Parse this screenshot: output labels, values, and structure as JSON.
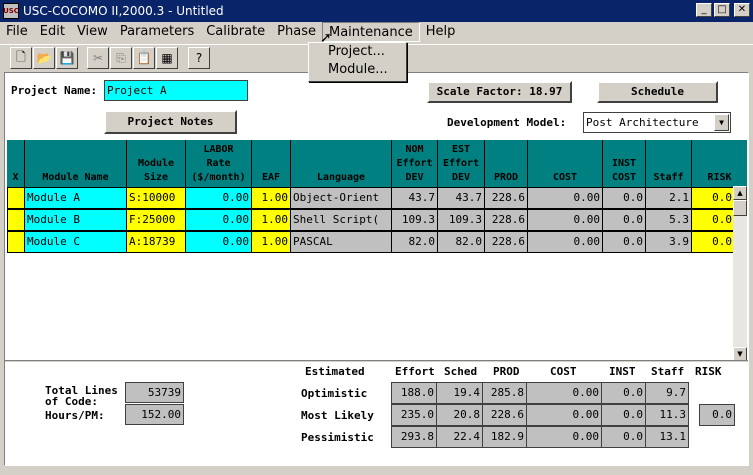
{
  "window": {
    "title": "USC-COCOMO II,2000.3 - Untitled",
    "icon_label": "USC"
  },
  "menu": [
    "File",
    "Edit",
    "View",
    "Parameters",
    "Calibrate",
    "Phase",
    "Maintenance",
    "Help"
  ],
  "maintenance_menu": [
    "Project...",
    "Module..."
  ],
  "toolbar_icons": [
    "new-file-icon",
    "open-folder-icon",
    "save-icon",
    "cut-icon",
    "copy-icon",
    "paste-icon",
    "insert-module-icon",
    "help-icon"
  ],
  "project": {
    "name_label": "Project Name:",
    "name_value": "Project A",
    "notes_button": "Project Notes",
    "scale_factor_button": "Scale Factor: 18.97",
    "schedule_button": "Schedule",
    "dev_model_label": "Development Model:",
    "dev_model_value": "Post Architecture"
  },
  "grid": {
    "headers": [
      "X",
      "Module Name",
      "Module\nSize",
      "LABOR\nRate\n($/month)",
      "EAF",
      "Language",
      "NOM\nEffort\nDEV",
      "EST\nEffort\nDEV",
      "PROD",
      "COST",
      "INST\nCOST",
      "Staff",
      "RISK"
    ],
    "rows": [
      {
        "x": "",
        "name": "Module A",
        "size": "S:10000",
        "labor": "0.00",
        "eaf": "1.00",
        "language": "Object-Orient",
        "nom": "43.7",
        "est": "43.7",
        "prod": "228.6",
        "cost": "0.00",
        "inst": "0.0",
        "staff": "2.1",
        "risk": "0.0"
      },
      {
        "x": "",
        "name": "Module B",
        "size": "F:25000",
        "labor": "0.00",
        "eaf": "1.00",
        "language": "Shell Script(",
        "nom": "109.3",
        "est": "109.3",
        "prod": "228.6",
        "cost": "0.00",
        "inst": "0.0",
        "staff": "5.3",
        "risk": "0.0"
      },
      {
        "x": "",
        "name": "Module C",
        "size": "A:18739",
        "labor": "0.00",
        "eaf": "1.00",
        "language": "PASCAL",
        "nom": "82.0",
        "est": "82.0",
        "prod": "228.6",
        "cost": "0.00",
        "inst": "0.0",
        "staff": "3.9",
        "risk": "0.0"
      }
    ]
  },
  "summary": {
    "total_loc_label_1": "Total Lines",
    "total_loc_label_2": "of Code:",
    "total_loc": "53739",
    "hours_label": "Hours/PM:",
    "hours": "152.00",
    "est_headers": [
      "Estimated",
      "Effort",
      "Sched",
      "PROD",
      "COST",
      "INST",
      "Staff",
      "RISK"
    ],
    "estimates": [
      {
        "label": "Optimistic",
        "effort": "188.0",
        "sched": "19.4",
        "prod": "285.8",
        "cost": "0.00",
        "inst": "0.0",
        "staff": "9.7",
        "risk": ""
      },
      {
        "label": "Most Likely",
        "effort": "235.0",
        "sched": "20.8",
        "prod": "228.6",
        "cost": "0.00",
        "inst": "0.0",
        "staff": "11.3",
        "risk": "0.0"
      },
      {
        "label": "Pessimistic",
        "effort": "293.8",
        "sched": "22.4",
        "prod": "182.9",
        "cost": "0.00",
        "inst": "0.0",
        "staff": "13.1",
        "risk": ""
      }
    ]
  }
}
